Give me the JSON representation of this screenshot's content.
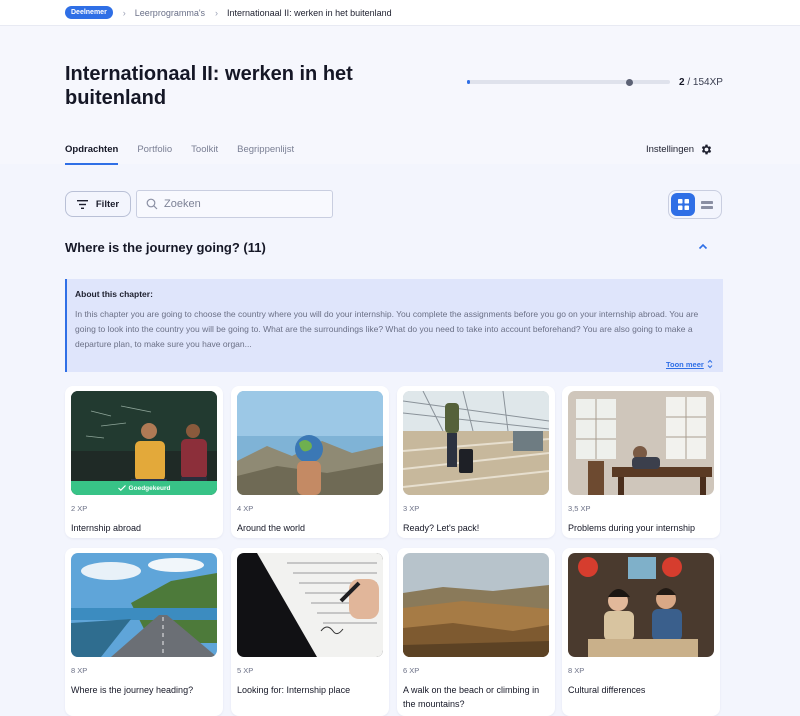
{
  "breadcrumb": {
    "role": "Deelnemer",
    "items": [
      "Leerprogramma's",
      "Internationaal II: werken in het buitenland"
    ]
  },
  "header": {
    "title": "Internationaal II: werken in het buitenland",
    "xp_current": "2",
    "xp_total": " / 154XP",
    "xp_progress_fraction": 0.8
  },
  "tabs": [
    {
      "label": "Opdrachten",
      "active": true
    },
    {
      "label": "Portfolio"
    },
    {
      "label": "Toolkit"
    },
    {
      "label": "Begrippenlijst"
    }
  ],
  "settings_label": "Instellingen",
  "toolbar": {
    "filter_label": "Filter",
    "search_placeholder": "Zoeken",
    "view_mode": "grid"
  },
  "chapter": {
    "title": "Where is the journey going? (11)",
    "about_heading": "About this chapter:",
    "about_text": "In this chapter you are going to choose the country where you will do your internship. You complete the assignments before you go on your internship abroad. You are going to look into the country you will be going to. What are the surroundings like? What do you need to take into account beforehand? You are also going to make a departure plan, to make sure you have organ...",
    "show_more": "Toon meer"
  },
  "cards": [
    {
      "xp": "2 XP",
      "title": "Internship abroad",
      "status": "Goedgekeurd"
    },
    {
      "xp": "4 XP",
      "title": "Around the world"
    },
    {
      "xp": "3 XP",
      "title": "Ready? Let's pack!"
    },
    {
      "xp": "3,5 XP",
      "title": "Problems during your internship"
    },
    {
      "xp": "8 XP",
      "title": "Where is the journey heading?"
    },
    {
      "xp": "5 XP",
      "title": "Looking for: Internship place"
    },
    {
      "xp": "6 XP",
      "title": "A walk on the beach or climbing in the mountains?"
    },
    {
      "xp": "8 XP",
      "title": "Cultural differences"
    }
  ],
  "colors": {
    "accent": "#2f6fe6",
    "approved": "#38c387",
    "about_bg": "#dfe5fb"
  }
}
